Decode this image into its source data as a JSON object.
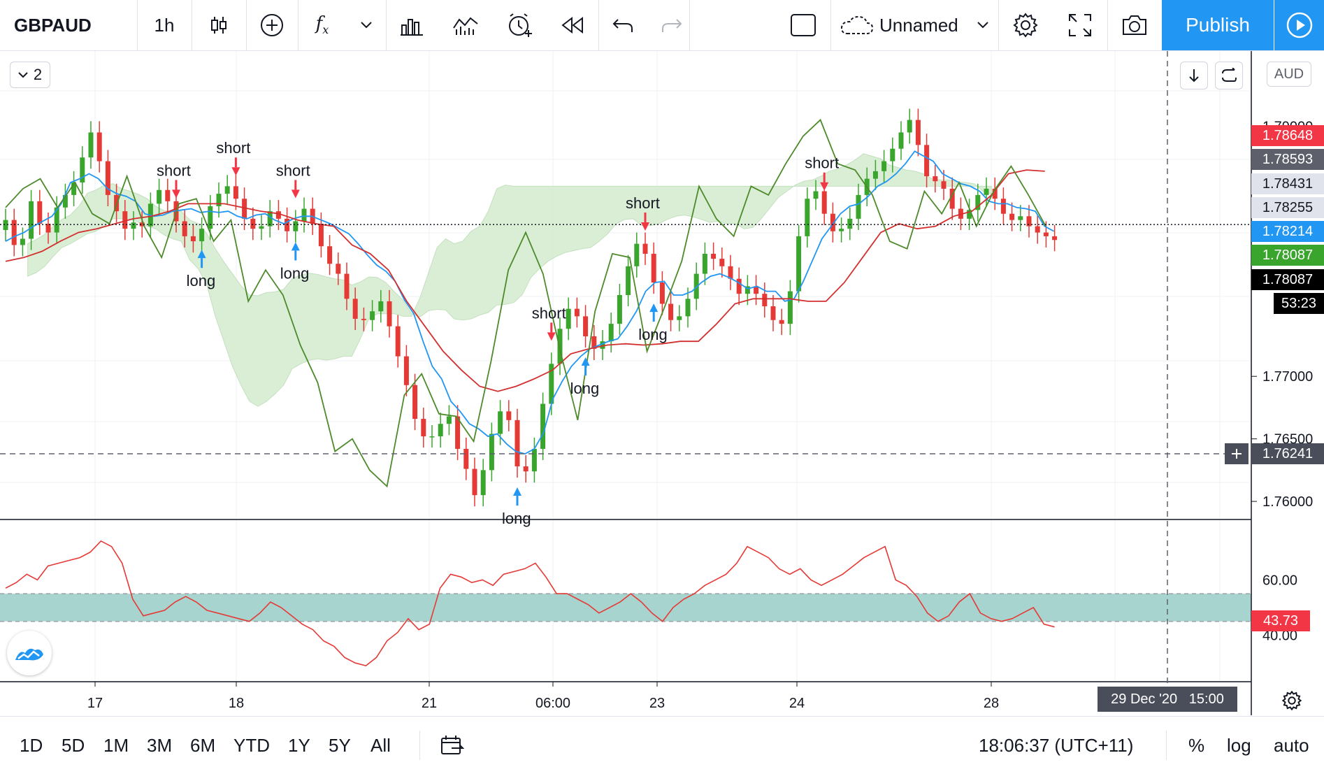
{
  "toolbar": {
    "symbol": "GBPAUD",
    "interval": "1h",
    "layout_name": "Unnamed",
    "publish_label": "Publish",
    "icons": [
      "candles-icon",
      "add-compare-icon",
      "indicators-icon",
      "chevron-down-icon",
      "templates-icon",
      "alert-icon",
      "replay-icon",
      "undo-icon",
      "redo-icon",
      "layout-icon",
      "cloud-icon",
      "chevron-down-icon",
      "settings-icon",
      "fullscreen-icon",
      "camera-icon",
      "play-icon"
    ]
  },
  "legend_toggle": {
    "count": "2"
  },
  "currency": "AUD",
  "price_axis": {
    "ticks": [
      "1.79000",
      "1.77000",
      "1.76500",
      "1.76000"
    ],
    "labels": [
      {
        "text": "1.78648",
        "bg": "#f23645",
        "fg": "#ffffff"
      },
      {
        "text": "1.78593",
        "bg": "#5d606b",
        "fg": "#ffffff"
      },
      {
        "text": "1.78431",
        "bg": "#e0e3eb",
        "fg": "#131722"
      },
      {
        "text": "1.78255",
        "bg": "#e0e3eb",
        "fg": "#131722"
      },
      {
        "text": "1.78214",
        "bg": "#2196f3",
        "fg": "#ffffff"
      },
      {
        "text": "1.78087",
        "bg": "#3aa52d",
        "fg": "#ffffff"
      },
      {
        "text": "1.78087",
        "bg": "#000000",
        "fg": "#ffffff"
      },
      {
        "text": "53:23",
        "bg": "#000000",
        "fg": "#ffffff"
      },
      {
        "text": "1.76241",
        "bg": "#4a4e5a",
        "fg": "#ffffff"
      }
    ]
  },
  "rsi_axis": {
    "ticks": [
      "60.00",
      "40.00"
    ],
    "value": "43.73",
    "value_bg": "#f23645"
  },
  "time_axis": {
    "ticks": [
      "17",
      "18",
      "21",
      "06:00",
      "23",
      "24",
      "28"
    ],
    "crosshair_label": "29 Dec '20   15:00"
  },
  "signals": {
    "short": "short",
    "long": "long"
  },
  "bottom": {
    "ranges": [
      "1D",
      "5D",
      "1M",
      "3M",
      "6M",
      "YTD",
      "1Y",
      "5Y",
      "All"
    ],
    "clock": "18:06:37 (UTC+11)",
    "percent": "%",
    "log": "log",
    "auto": "auto"
  },
  "colors": {
    "up": "#3aa52d",
    "down": "#e53935",
    "cloud": "#d4ecd0",
    "cloud_bear": "#9e9fa3",
    "tenkan": "#2196f3",
    "kijun": "#d32f2f",
    "chikou": "#4c8a2a",
    "rsi": "#e53935",
    "rsi_band": "#a8d4cf",
    "accent": "#2196f3"
  },
  "chart_data": {
    "type": "candlestick",
    "symbol": "GBPAUD",
    "ylim": [
      1.759,
      1.7945
    ],
    "closes": [
      1.7825,
      1.7805,
      1.781,
      1.784,
      1.7822,
      1.7815,
      1.7835,
      1.7845,
      1.7855,
      1.7875,
      1.7895,
      1.7872,
      1.7845,
      1.7832,
      1.7818,
      1.7823,
      1.782,
      1.7838,
      1.7849,
      1.784,
      1.7824,
      1.7812,
      1.7808,
      1.7818,
      1.7836,
      1.7846,
      1.7852,
      1.7842,
      1.7826,
      1.7818,
      1.782,
      1.7832,
      1.7826,
      1.7816,
      1.7824,
      1.7834,
      1.7822,
      1.7804,
      1.779,
      1.7782,
      1.7762,
      1.7746,
      1.7745,
      1.7752,
      1.776,
      1.774,
      1.7716,
      1.7693,
      1.7666,
      1.7652,
      1.7652,
      1.7662,
      1.7668,
      1.7642,
      1.7626,
      1.7605,
      1.7625,
      1.7654,
      1.7672,
      1.7665,
      1.7628,
      1.7624,
      1.7642,
      1.7678,
      1.771,
      1.7738,
      1.7754,
      1.7748,
      1.7732,
      1.7722,
      1.7728,
      1.7742,
      1.7765,
      1.7788,
      1.7806,
      1.7798,
      1.7775,
      1.7758,
      1.7745,
      1.7748,
      1.7762,
      1.7782,
      1.7798,
      1.7794,
      1.7788,
      1.7778,
      1.7766,
      1.7772,
      1.7766,
      1.7756,
      1.7745,
      1.7742,
      1.7768,
      1.7812,
      1.7842,
      1.7848,
      1.783,
      1.7816,
      1.7818,
      1.7826,
      1.7845,
      1.7858,
      1.7864,
      1.7872,
      1.7882,
      1.7895,
      1.7905,
      1.7885,
      1.786,
      1.7856,
      1.785,
      1.7834,
      1.7826,
      1.7833,
      1.7845,
      1.785,
      1.7842,
      1.783,
      1.7825,
      1.7828,
      1.782,
      1.7815,
      1.7812,
      1.7809
    ],
    "series": [
      {
        "name": "tenkan",
        "values": [
          1.7808,
          1.7812,
          1.7815,
          1.782,
          1.7824,
          1.7828,
          1.7838,
          1.7855,
          1.7858,
          1.7862,
          1.7858,
          1.785,
          1.7846,
          1.7844,
          1.784,
          1.783,
          1.7828,
          1.7829,
          1.7832,
          1.7833,
          1.7834,
          1.7831,
          1.7832,
          1.7831,
          1.7832,
          1.7828,
          1.7826,
          1.7829,
          1.783,
          1.7825,
          1.7822,
          1.7826,
          1.7828,
          1.7828,
          1.7825,
          1.7822,
          1.7818,
          1.7814,
          1.7806,
          1.7797,
          1.7789,
          1.7784,
          1.7776,
          1.7761,
          1.775,
          1.7728,
          1.7708,
          1.7698,
          1.768,
          1.7672,
          1.7662,
          1.7658,
          1.7652,
          1.7654,
          1.7646,
          1.764,
          1.7638,
          1.7642,
          1.7655,
          1.7682,
          1.7696,
          1.7708,
          1.7716,
          1.7722,
          1.7725,
          1.7728,
          1.773,
          1.774,
          1.7752,
          1.7768,
          1.7775,
          1.7776,
          1.7765,
          1.7765,
          1.7768,
          1.7775,
          1.778,
          1.7782,
          1.7779,
          1.7775,
          1.777,
          1.7772,
          1.7768,
          1.7768,
          1.776,
          1.7762,
          1.7776,
          1.7793,
          1.781,
          1.782,
          1.783,
          1.7836,
          1.7838,
          1.7844,
          1.7852,
          1.7856,
          1.7862,
          1.787,
          1.788,
          1.7876,
          1.7872,
          1.7862,
          1.7858,
          1.7854,
          1.7852,
          1.7848,
          1.784,
          1.7838,
          1.7838,
          1.7835,
          1.7834,
          1.7832,
          1.782,
          1.7816
        ]
      },
      {
        "name": "kijun",
        "values": [
          1.7792,
          1.7795,
          1.78,
          1.7808,
          1.7815,
          1.7818,
          1.7822,
          1.7826,
          1.7828,
          1.7832,
          1.7838,
          1.7838,
          1.7838,
          1.7835,
          1.7832,
          1.783,
          1.7825,
          1.7822,
          1.782,
          1.7805,
          1.7798,
          1.7785,
          1.776,
          1.774,
          1.772,
          1.7705,
          1.7692,
          1.7688,
          1.7692,
          1.7698,
          1.7705,
          1.7718,
          1.7722,
          1.7725,
          1.7726,
          1.7725,
          1.7726,
          1.7728,
          1.7728,
          1.7742,
          1.7758,
          1.7762,
          1.7762,
          1.7762,
          1.776,
          1.776,
          1.7775,
          1.7795,
          1.7815,
          1.7822,
          1.7818,
          1.782,
          1.7828,
          1.7832,
          1.7844,
          1.7862,
          1.7865,
          1.7864
        ]
      },
      {
        "name": "chikou",
        "values": [
          1.7835,
          1.785,
          1.7858,
          1.7835,
          1.7855,
          1.783,
          1.7822,
          1.786,
          1.782,
          1.7795,
          1.7838,
          1.7842,
          1.7808,
          1.7825,
          1.776,
          1.7785,
          1.7765,
          1.7725,
          1.7695,
          1.764,
          1.765,
          1.7625,
          1.7612,
          1.7685,
          1.7702,
          1.767,
          1.7668,
          1.7648,
          1.7712,
          1.7785,
          1.7815,
          1.7782,
          1.772,
          1.7665,
          1.7752,
          1.7798,
          1.7795,
          1.772,
          1.7755,
          1.7792,
          1.7852,
          1.7826,
          1.7812,
          1.7852,
          1.7845,
          1.787,
          1.7892,
          1.7905,
          1.787,
          1.7865,
          1.7845,
          1.7808,
          1.7802,
          1.7848,
          1.783,
          1.7855,
          1.782,
          1.7848,
          1.7868,
          1.7845,
          1.782
        ]
      }
    ],
    "signals": [
      {
        "label": "short"
      },
      {
        "label": "short"
      },
      {
        "label": "short"
      },
      {
        "label": "short"
      },
      {
        "label": "short"
      },
      {
        "label": "short"
      },
      {
        "label": "long"
      },
      {
        "label": "long"
      },
      {
        "label": "long"
      },
      {
        "label": "long"
      },
      {
        "label": "long"
      }
    ],
    "rsi": {
      "ylim": [
        25,
        80
      ],
      "band": [
        45,
        55
      ],
      "values": [
        57,
        59,
        62,
        60,
        65,
        66,
        67,
        68,
        70,
        74,
        72,
        66,
        53,
        47,
        48,
        49,
        52,
        54,
        52,
        49,
        48,
        47,
        46,
        45,
        48,
        52,
        50,
        47,
        44,
        42,
        38,
        36,
        32,
        30,
        29,
        32,
        38,
        41,
        46,
        42,
        44,
        57,
        62,
        61,
        59,
        60,
        58,
        62,
        63,
        64,
        66,
        61,
        55,
        55,
        53,
        51,
        48,
        50,
        52,
        55,
        52,
        48,
        45,
        50,
        53,
        55,
        58,
        60,
        62,
        66,
        72,
        70,
        68,
        64,
        62,
        64,
        60,
        58,
        60,
        62,
        65,
        68,
        70,
        72,
        60,
        58,
        54,
        48,
        45,
        47,
        52,
        55,
        48,
        46,
        45,
        46,
        48,
        50,
        44,
        43
      ]
    }
  }
}
